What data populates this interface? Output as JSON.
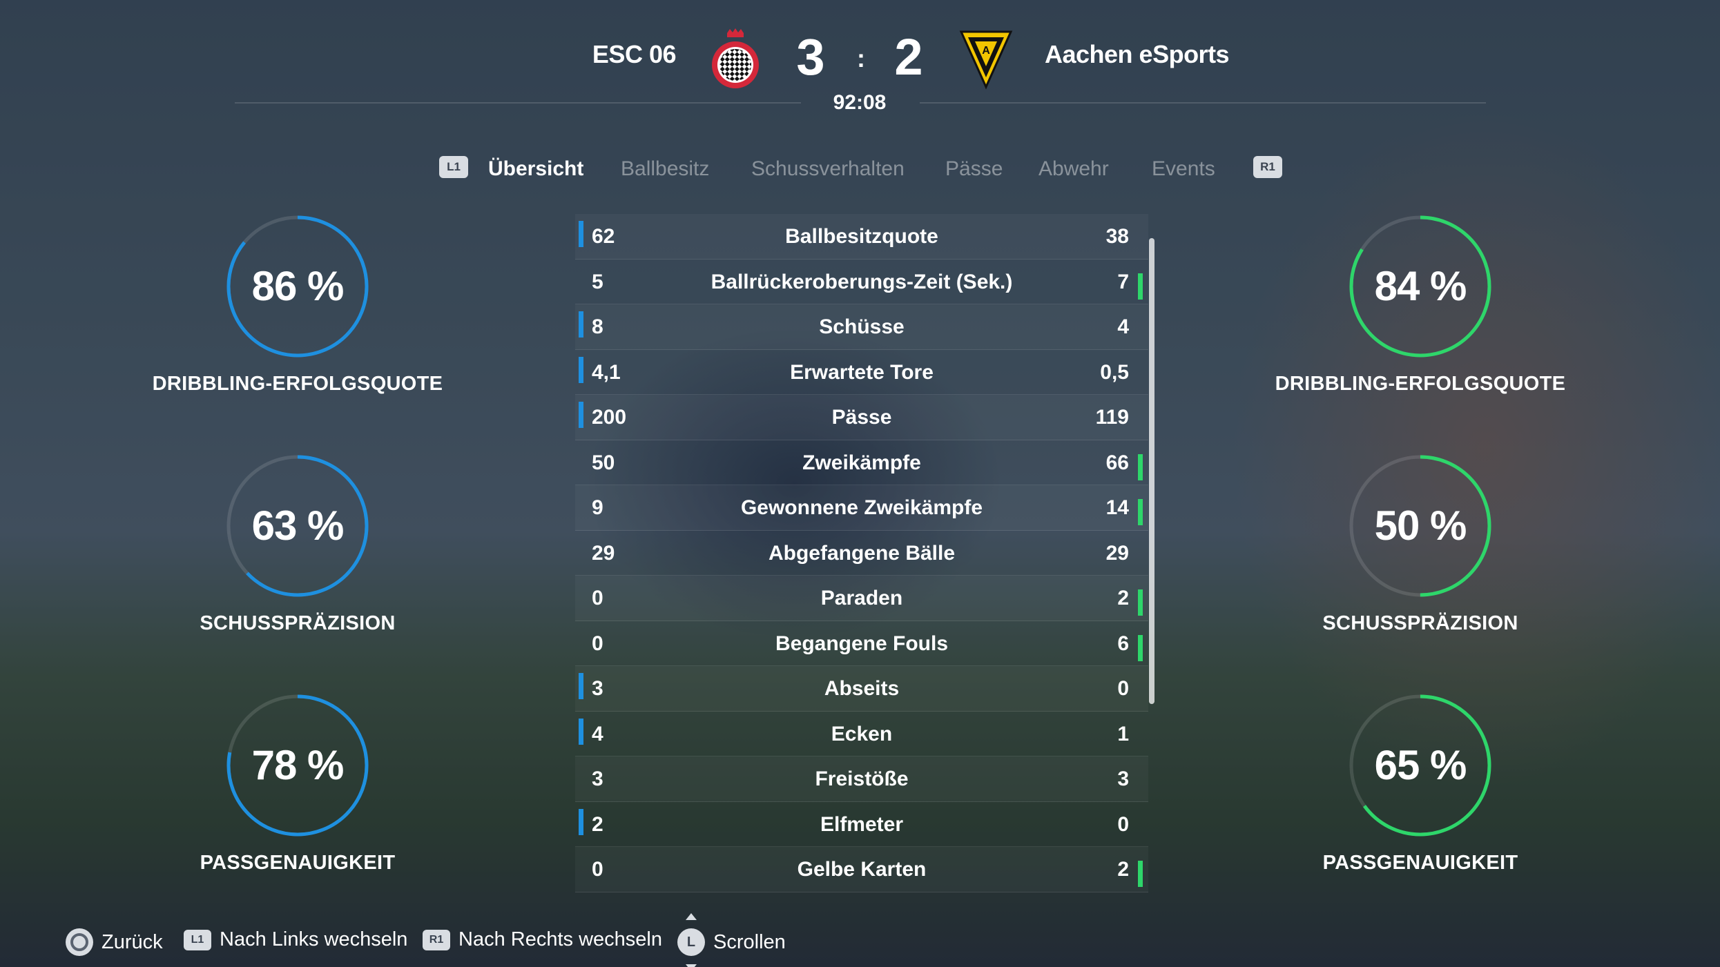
{
  "header": {
    "home_team": "ESC 06",
    "away_team": "Aachen eSports",
    "home_score": "3",
    "away_score": "2",
    "separator": ":",
    "clock": "92:08",
    "home_crest_icon": "checkered-shield-crest-icon",
    "away_crest_icon": "yellow-black-shield-crest-icon",
    "home_color": "#d4283a",
    "away_color": "#f2c500"
  },
  "tabs": {
    "left_button": "L1",
    "right_button": "R1",
    "items": [
      {
        "label": "Übersicht",
        "active": true
      },
      {
        "label": "Ballbesitz",
        "active": false
      },
      {
        "label": "Schussverhalten",
        "active": false
      },
      {
        "label": "Pässe",
        "active": false
      },
      {
        "label": "Abwehr",
        "active": false
      },
      {
        "label": "Events",
        "active": false
      }
    ]
  },
  "colors": {
    "home_accent": "#1e90e0",
    "away_accent": "#2ed66a"
  },
  "home_rings": [
    {
      "value": "86 %",
      "percent": 86,
      "label": "DRIBBLING-ERFOLGSQUOTE"
    },
    {
      "value": "63 %",
      "percent": 63,
      "label": "SCHUSSPRÄZISION"
    },
    {
      "value": "78 %",
      "percent": 78,
      "label": "PASSGENAUIGKEIT"
    }
  ],
  "away_rings": [
    {
      "value": "84 %",
      "percent": 84,
      "label": "DRIBBLING-ERFOLGSQUOTE"
    },
    {
      "value": "50 %",
      "percent": 50,
      "label": "SCHUSSPRÄZISION"
    },
    {
      "value": "65 %",
      "percent": 65,
      "label": "PASSGENAUIGKEIT"
    }
  ],
  "stats": [
    {
      "name": "Ballbesitzquote",
      "home": "62",
      "away": "38",
      "leader": "home"
    },
    {
      "name": "Ballrückeroberungs-Zeit (Sek.)",
      "home": "5",
      "away": "7",
      "leader": "away"
    },
    {
      "name": "Schüsse",
      "home": "8",
      "away": "4",
      "leader": "home"
    },
    {
      "name": "Erwartete Tore",
      "home": "4,1",
      "away": "0,5",
      "leader": "home"
    },
    {
      "name": "Pässe",
      "home": "200",
      "away": "119",
      "leader": "home"
    },
    {
      "name": "Zweikämpfe",
      "home": "50",
      "away": "66",
      "leader": "away"
    },
    {
      "name": "Gewonnene Zweikämpfe",
      "home": "9",
      "away": "14",
      "leader": "away"
    },
    {
      "name": "Abgefangene Bälle",
      "home": "29",
      "away": "29",
      "leader": "none"
    },
    {
      "name": "Paraden",
      "home": "0",
      "away": "2",
      "leader": "away"
    },
    {
      "name": "Begangene Fouls",
      "home": "0",
      "away": "6",
      "leader": "away"
    },
    {
      "name": "Abseits",
      "home": "3",
      "away": "0",
      "leader": "home"
    },
    {
      "name": "Ecken",
      "home": "4",
      "away": "1",
      "leader": "home"
    },
    {
      "name": "Freistöße",
      "home": "3",
      "away": "3",
      "leader": "none"
    },
    {
      "name": "Elfmeter",
      "home": "2",
      "away": "0",
      "leader": "home"
    },
    {
      "name": "Gelbe Karten",
      "home": "0",
      "away": "2",
      "leader": "away"
    }
  ],
  "footer": {
    "back_label": "Zurück",
    "left_button": "L1",
    "left_label": "Nach Links wechseln",
    "right_button": "R1",
    "right_label": "Nach Rechts wechseln",
    "stick_button": "L",
    "scroll_label": "Scrollen"
  }
}
